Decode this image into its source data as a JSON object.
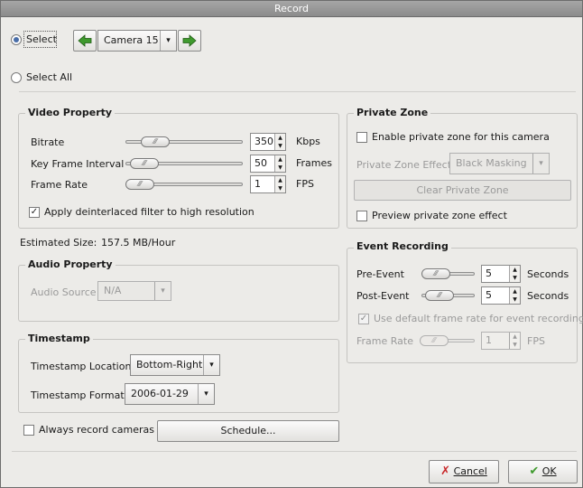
{
  "window": {
    "title": "Record"
  },
  "selection": {
    "select_label": "Select",
    "select_all_label": "Select All",
    "camera_value": "Camera 15"
  },
  "video_property": {
    "title": "Video Property",
    "bitrate_label": "Bitrate",
    "bitrate_value": "350",
    "bitrate_unit": "Kbps",
    "keyframe_label": "Key Frame Interval",
    "keyframe_value": "50",
    "keyframe_unit": "Frames",
    "framerate_label": "Frame Rate",
    "framerate_value": "1",
    "framerate_unit": "FPS",
    "deinterlace_label": "Apply deinterlaced filter to high resolution"
  },
  "estimated_size": {
    "label": "Estimated Size:",
    "value": "157.5 MB/Hour"
  },
  "audio_property": {
    "title": "Audio Property",
    "source_label": "Audio Source",
    "source_value": "N/A"
  },
  "timestamp": {
    "title": "Timestamp",
    "location_label": "Timestamp Location",
    "location_value": "Bottom-Right",
    "format_label": "Timestamp Format",
    "format_value": "2006-01-29"
  },
  "always_record": {
    "label": "Always record cameras",
    "schedule_button": "Schedule..."
  },
  "private_zone": {
    "title": "Private Zone",
    "enable_label": "Enable private zone for this camera",
    "effect_label": "Private Zone Effect",
    "effect_value": "Black Masking",
    "clear_button": "Clear Private Zone",
    "preview_label": "Preview private zone effect"
  },
  "event_recording": {
    "title": "Event Recording",
    "pre_label": "Pre-Event",
    "pre_value": "5",
    "pre_unit": "Seconds",
    "post_label": "Post-Event",
    "post_value": "5",
    "post_unit": "Seconds",
    "default_rate_label": "Use default frame rate for event recording",
    "framerate_label": "Frame Rate",
    "framerate_value": "1",
    "framerate_unit": "FPS"
  },
  "footer": {
    "cancel_label": "Cancel",
    "ok_label": "OK"
  },
  "icons": {
    "prev": "arrow-left-icon",
    "next": "arrow-right-icon",
    "cancel": "x-icon",
    "ok": "check-icon"
  },
  "colors": {
    "arrow_green": "#3f9a2e",
    "cancel_red": "#c8282a",
    "radio_blue": "#4a6ea8"
  }
}
